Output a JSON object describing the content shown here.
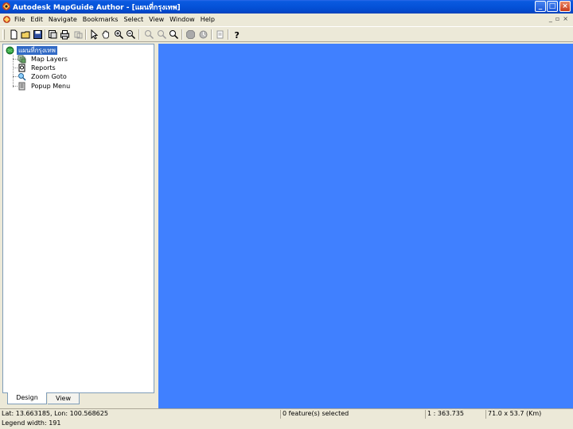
{
  "window": {
    "title": "Autodesk MapGuide Author - [แผนที่กรุงเทพ]",
    "minimize_label": "_",
    "maximize_label": "□",
    "close_label": "×"
  },
  "menu": {
    "items": [
      "File",
      "Edit",
      "Navigate",
      "Bookmarks",
      "Select",
      "View",
      "Window",
      "Help"
    ],
    "mdi_minimize": "_",
    "mdi_restore": "▫",
    "mdi_close": "×"
  },
  "toolbar": {
    "icons": [
      "new-icon",
      "open-icon",
      "save-icon",
      "publish-icon",
      "print-icon",
      "copy-icon",
      "select-arrow-icon",
      "pan-hand-icon",
      "zoom-in-icon",
      "zoom-out-icon",
      "zoom-previous-icon",
      "zoom-window-icon",
      "zoom-extents-icon",
      "stop-icon",
      "refresh-icon",
      "properties-icon",
      "help-icon"
    ]
  },
  "tree": {
    "root_label": "แผนที่กรุงเทพ",
    "items": [
      {
        "label": "Map Layers",
        "icon": "layers-icon"
      },
      {
        "label": "Reports",
        "icon": "reports-icon"
      },
      {
        "label": "Zoom Goto",
        "icon": "zoom-goto-icon"
      },
      {
        "label": "Popup Menu",
        "icon": "popup-menu-icon"
      }
    ]
  },
  "tabs": {
    "design": "Design",
    "view": "View"
  },
  "colors": {
    "map_background": "#4080ff",
    "titlebar": "#0552d8",
    "selection": "#316ac5"
  },
  "status": {
    "coordinates": "Lat: 13.663185, Lon: 100.568625",
    "selection": "0 feature(s) selected",
    "scale": "1 : 363.735",
    "dimensions": "71.0 x 53.7 (Km)",
    "legend_width": "Legend width: 191"
  }
}
